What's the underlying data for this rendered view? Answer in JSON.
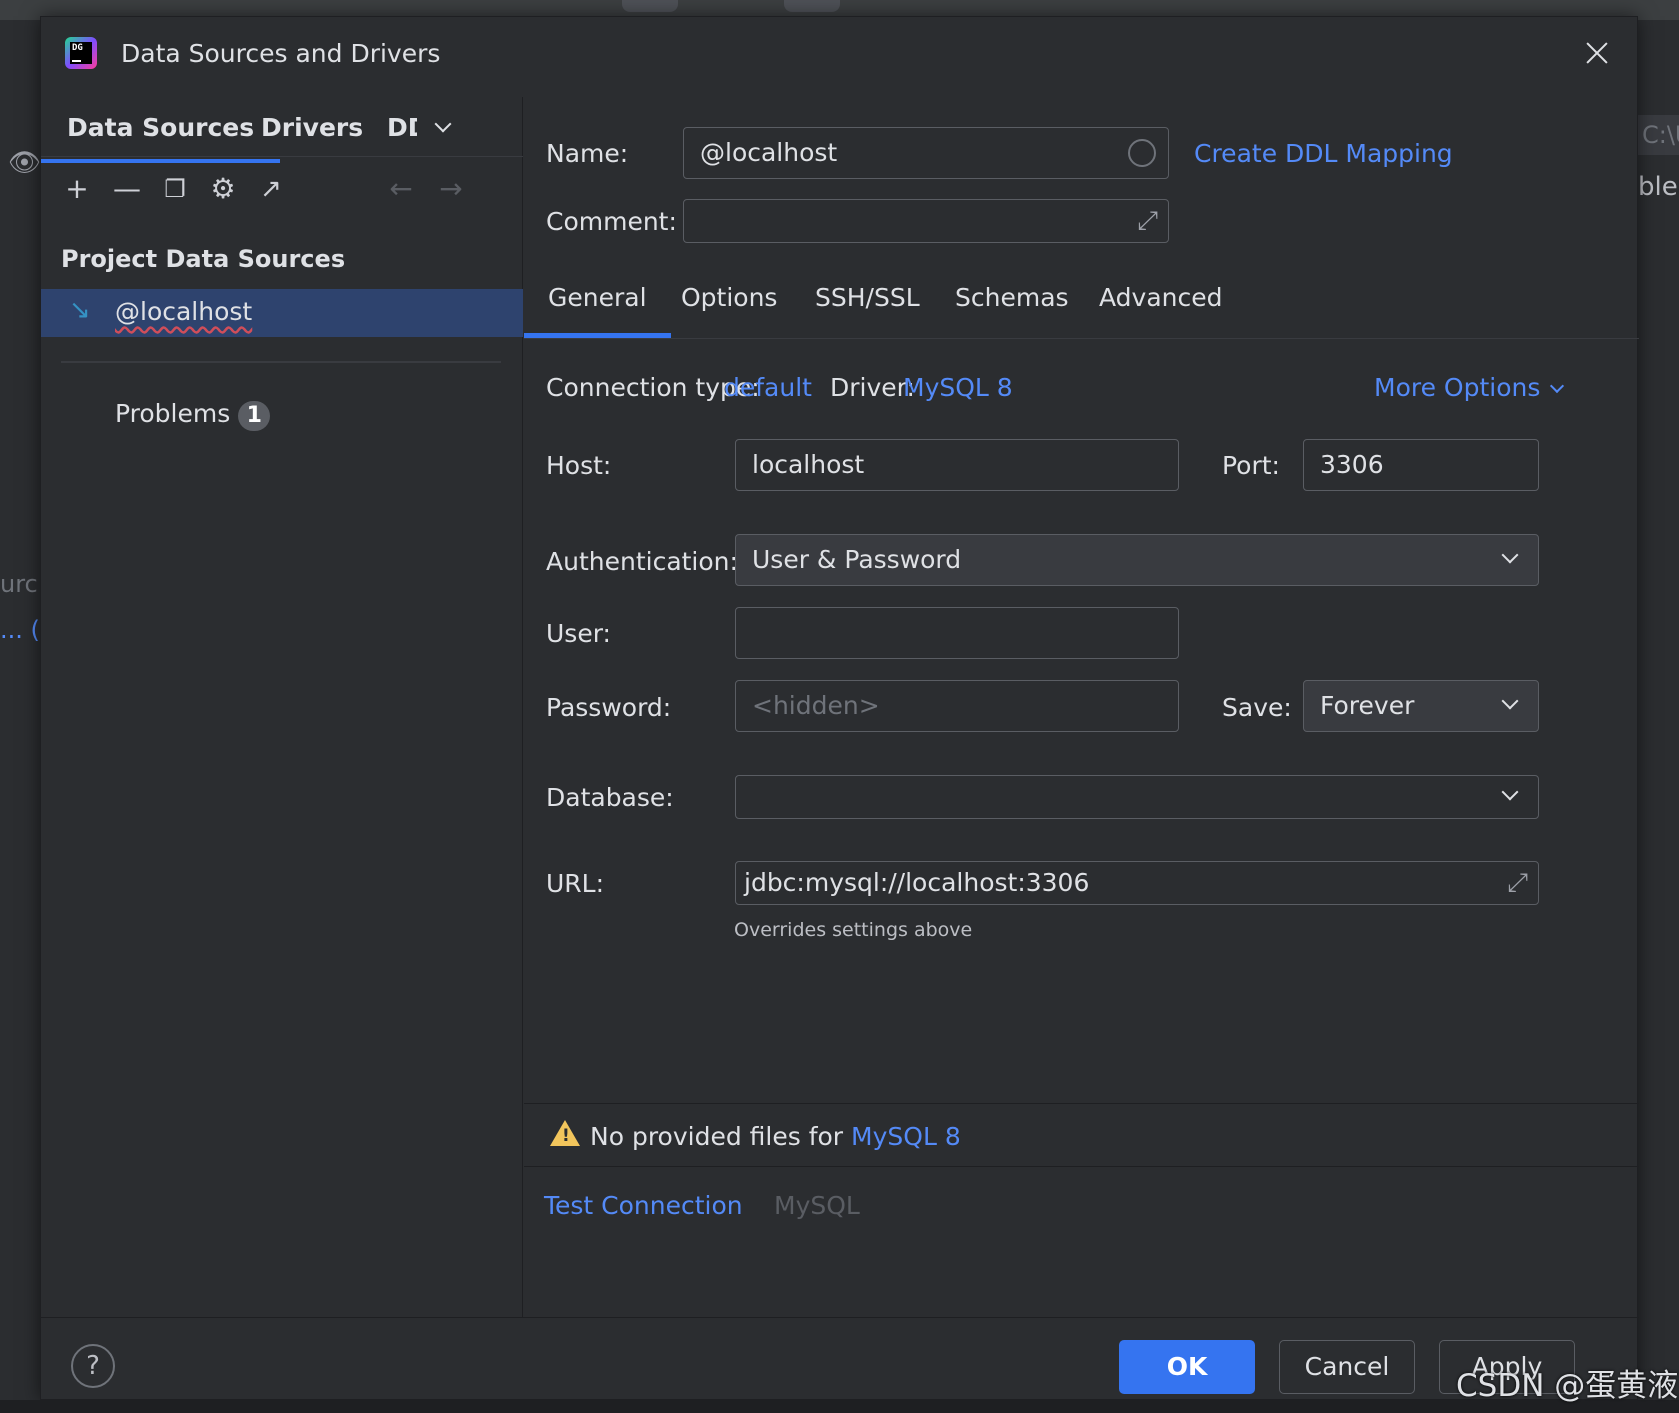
{
  "background": {
    "left_fragments": [
      "urc",
      "... (A"
    ],
    "right_fragments": [
      "C:\\U",
      "bles"
    ]
  },
  "dialog": {
    "title": "Data Sources and Drivers",
    "app_logo_text": "DG"
  },
  "left_pane": {
    "tabs": [
      "Data Sources",
      "Drivers",
      "DD"
    ],
    "section_title": "Project Data Sources",
    "data_sources": [
      {
        "label": "@localhost",
        "icon": "mysql-dolphin-icon"
      }
    ],
    "problems": {
      "label": "Problems",
      "count": "1"
    }
  },
  "right_pane": {
    "name": {
      "label": "Name:",
      "value": "@localhost"
    },
    "create_ddl": "Create DDL Mapping",
    "comment": {
      "label": "Comment:",
      "value": ""
    },
    "tabs": [
      "General",
      "Options",
      "SSH/SSL",
      "Schemas",
      "Advanced"
    ],
    "active_tab": "General",
    "connection_type": {
      "label": "Connection type:",
      "value": "default"
    },
    "driver": {
      "label": "Driver:",
      "value": "MySQL 8"
    },
    "more_options": "More Options",
    "host": {
      "label": "Host:",
      "value": "localhost"
    },
    "port": {
      "label": "Port:",
      "value": "3306"
    },
    "authentication": {
      "label": "Authentication:",
      "value": "User & Password"
    },
    "user": {
      "label": "User:",
      "value": ""
    },
    "password": {
      "label": "Password:",
      "placeholder": "<hidden>"
    },
    "save": {
      "label": "Save:",
      "value": "Forever"
    },
    "database": {
      "label": "Database:",
      "value": ""
    },
    "url": {
      "label": "URL:",
      "value": "jdbc:mysql://localhost:3306",
      "hint": "Overrides settings above"
    },
    "warning": {
      "text": "No provided files for",
      "link": "MySQL 8"
    },
    "test_connection": "Test Connection",
    "driver_name": "MySQL"
  },
  "footer": {
    "ok": "OK",
    "cancel": "Cancel",
    "apply": "Apply"
  },
  "watermark": "CSDN @蛋黄液",
  "colors": {
    "accent": "#3574f0",
    "link": "#548af7",
    "background": "#2b2d30",
    "selection": "#2e436e",
    "warning": "#f2c55c"
  }
}
